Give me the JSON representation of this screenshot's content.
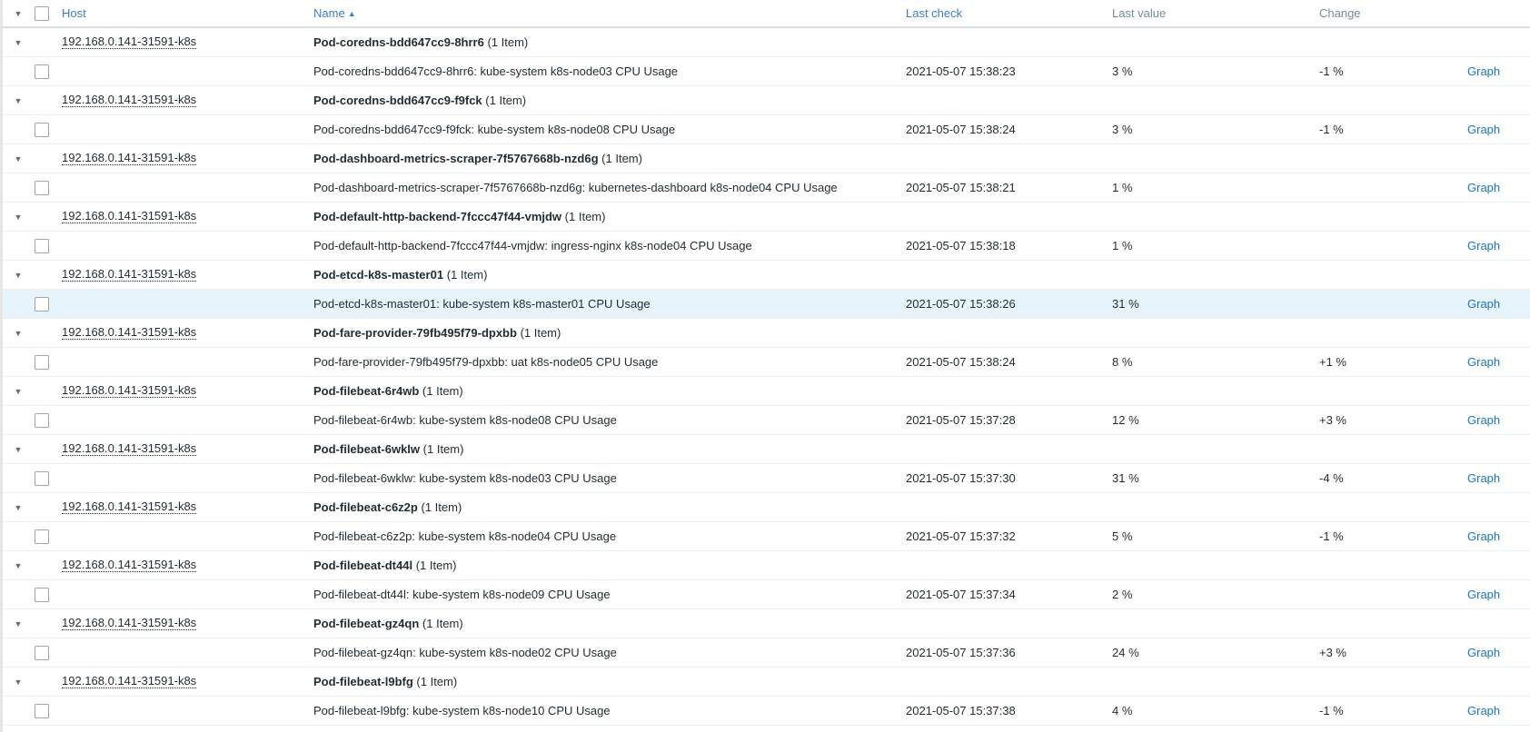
{
  "headers": {
    "host": "Host",
    "name": "Name",
    "sort_indicator": "▲",
    "last_check": "Last check",
    "last_value": "Last value",
    "change": "Change"
  },
  "groups": [
    {
      "host": "192.168.0.141-31591-k8s",
      "group_name": "Pod-coredns-bdd647cc9-8hrr6",
      "count_label": "(1 Item)",
      "item": {
        "name": "Pod-coredns-bdd647cc9-8hrr6: kube-system k8s-node03 CPU Usage",
        "last_check": "2021-05-07 15:38:23",
        "last_value": "3 %",
        "change": "-1 %",
        "action": "Graph"
      }
    },
    {
      "host": "192.168.0.141-31591-k8s",
      "group_name": "Pod-coredns-bdd647cc9-f9fck",
      "count_label": "(1 Item)",
      "item": {
        "name": "Pod-coredns-bdd647cc9-f9fck: kube-system k8s-node08 CPU Usage",
        "last_check": "2021-05-07 15:38:24",
        "last_value": "3 %",
        "change": "-1 %",
        "action": "Graph"
      }
    },
    {
      "host": "192.168.0.141-31591-k8s",
      "group_name": "Pod-dashboard-metrics-scraper-7f5767668b-nzd6g",
      "count_label": "(1 Item)",
      "item": {
        "name": "Pod-dashboard-metrics-scraper-7f5767668b-nzd6g: kubernetes-dashboard k8s-node04 CPU Usage",
        "last_check": "2021-05-07 15:38:21",
        "last_value": "1 %",
        "change": "",
        "action": "Graph"
      }
    },
    {
      "host": "192.168.0.141-31591-k8s",
      "group_name": "Pod-default-http-backend-7fccc47f44-vmjdw",
      "count_label": "(1 Item)",
      "item": {
        "name": "Pod-default-http-backend-7fccc47f44-vmjdw: ingress-nginx k8s-node04 CPU Usage",
        "last_check": "2021-05-07 15:38:18",
        "last_value": "1 %",
        "change": "",
        "action": "Graph"
      }
    },
    {
      "host": "192.168.0.141-31591-k8s",
      "group_name": "Pod-etcd-k8s-master01",
      "count_label": "(1 Item)",
      "item": {
        "name": "Pod-etcd-k8s-master01: kube-system k8s-master01 CPU Usage",
        "last_check": "2021-05-07 15:38:26",
        "last_value": "31 %",
        "change": "",
        "action": "Graph"
      }
    },
    {
      "host": "192.168.0.141-31591-k8s",
      "group_name": "Pod-fare-provider-79fb495f79-dpxbb",
      "count_label": "(1 Item)",
      "item": {
        "name": "Pod-fare-provider-79fb495f79-dpxbb: uat k8s-node05 CPU Usage",
        "last_check": "2021-05-07 15:38:24",
        "last_value": "8 %",
        "change": "+1 %",
        "action": "Graph"
      }
    },
    {
      "host": "192.168.0.141-31591-k8s",
      "group_name": "Pod-filebeat-6r4wb",
      "count_label": "(1 Item)",
      "item": {
        "name": "Pod-filebeat-6r4wb: kube-system k8s-node08 CPU Usage",
        "last_check": "2021-05-07 15:37:28",
        "last_value": "12 %",
        "change": "+3 %",
        "action": "Graph"
      }
    },
    {
      "host": "192.168.0.141-31591-k8s",
      "group_name": "Pod-filebeat-6wklw",
      "count_label": "(1 Item)",
      "item": {
        "name": "Pod-filebeat-6wklw: kube-system k8s-node03 CPU Usage",
        "last_check": "2021-05-07 15:37:30",
        "last_value": "31 %",
        "change": "-4 %",
        "action": "Graph"
      }
    },
    {
      "host": "192.168.0.141-31591-k8s",
      "group_name": "Pod-filebeat-c6z2p",
      "count_label": "(1 Item)",
      "item": {
        "name": "Pod-filebeat-c6z2p: kube-system k8s-node04 CPU Usage",
        "last_check": "2021-05-07 15:37:32",
        "last_value": "5 %",
        "change": "-1 %",
        "action": "Graph"
      }
    },
    {
      "host": "192.168.0.141-31591-k8s",
      "group_name": "Pod-filebeat-dt44l",
      "count_label": "(1 Item)",
      "item": {
        "name": "Pod-filebeat-dt44l: kube-system k8s-node09 CPU Usage",
        "last_check": "2021-05-07 15:37:34",
        "last_value": "2 %",
        "change": "",
        "action": "Graph"
      }
    },
    {
      "host": "192.168.0.141-31591-k8s",
      "group_name": "Pod-filebeat-gz4qn",
      "count_label": "(1 Item)",
      "item": {
        "name": "Pod-filebeat-gz4qn: kube-system k8s-node02 CPU Usage",
        "last_check": "2021-05-07 15:37:36",
        "last_value": "24 %",
        "change": "+3 %",
        "action": "Graph"
      }
    },
    {
      "host": "192.168.0.141-31591-k8s",
      "group_name": "Pod-filebeat-l9bfg",
      "count_label": "(1 Item)",
      "item": {
        "name": "Pod-filebeat-l9bfg: kube-system k8s-node10 CPU Usage",
        "last_check": "2021-05-07 15:37:38",
        "last_value": "4 %",
        "change": "-1 %",
        "action": "Graph"
      }
    }
  ],
  "selected_item": "Pod-etcd-k8s-master01: kube-system k8s-master01 CPU Usage"
}
